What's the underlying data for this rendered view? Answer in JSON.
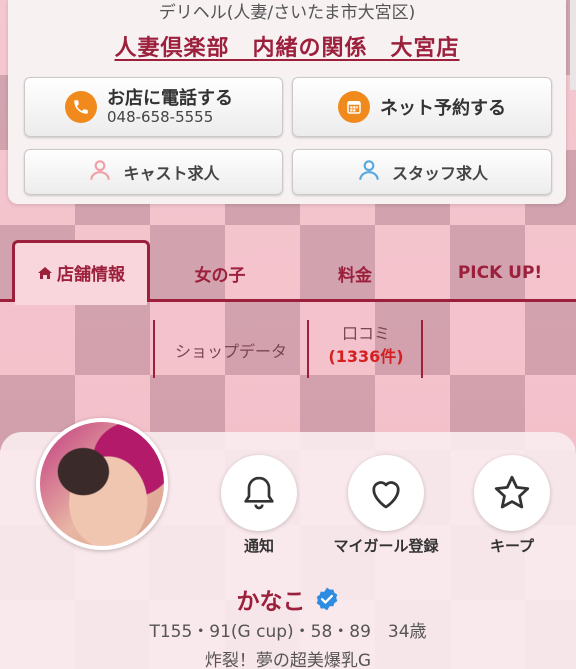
{
  "header": {
    "category": "デリヘル(人妻/さいたま市大宮区)",
    "shop_name": "人妻倶楽部　内緒の関係　大宮店",
    "call": {
      "label": "お店に電話する",
      "number": "048-658-5555",
      "icon": "phone-icon"
    },
    "reserve": {
      "label": "ネット予約する",
      "icon": "calendar-icon"
    },
    "cast": {
      "label": "キャスト求人",
      "icon": "person-icon"
    },
    "staff": {
      "label": "スタッフ求人",
      "icon": "person-icon"
    },
    "colors": {
      "call_icon": "#f08a1c",
      "reserve_icon": "#f08a1c",
      "cast_icon": "#f0a0a8",
      "staff_icon": "#5aa8e0"
    }
  },
  "tabs": {
    "shop_info": "店舗情報",
    "girls": "女の子",
    "price": "料金",
    "pickup": "PICK UP!"
  },
  "subnav": {
    "shop_data": "ショップデータ",
    "review": "口コミ",
    "review_count": "(1336件)"
  },
  "profile": {
    "actions": {
      "notify": "通知",
      "mygirl": "マイガール登録",
      "keep": "キープ"
    },
    "name": "かなこ",
    "stats": "T155・91(G cup)・58・89　34歳",
    "catch": "炸裂！夢の超美爆乳G"
  },
  "theme": {
    "accent": "#9c1f3c",
    "review_count": "#d42020",
    "verified": "#2f8ce0"
  }
}
